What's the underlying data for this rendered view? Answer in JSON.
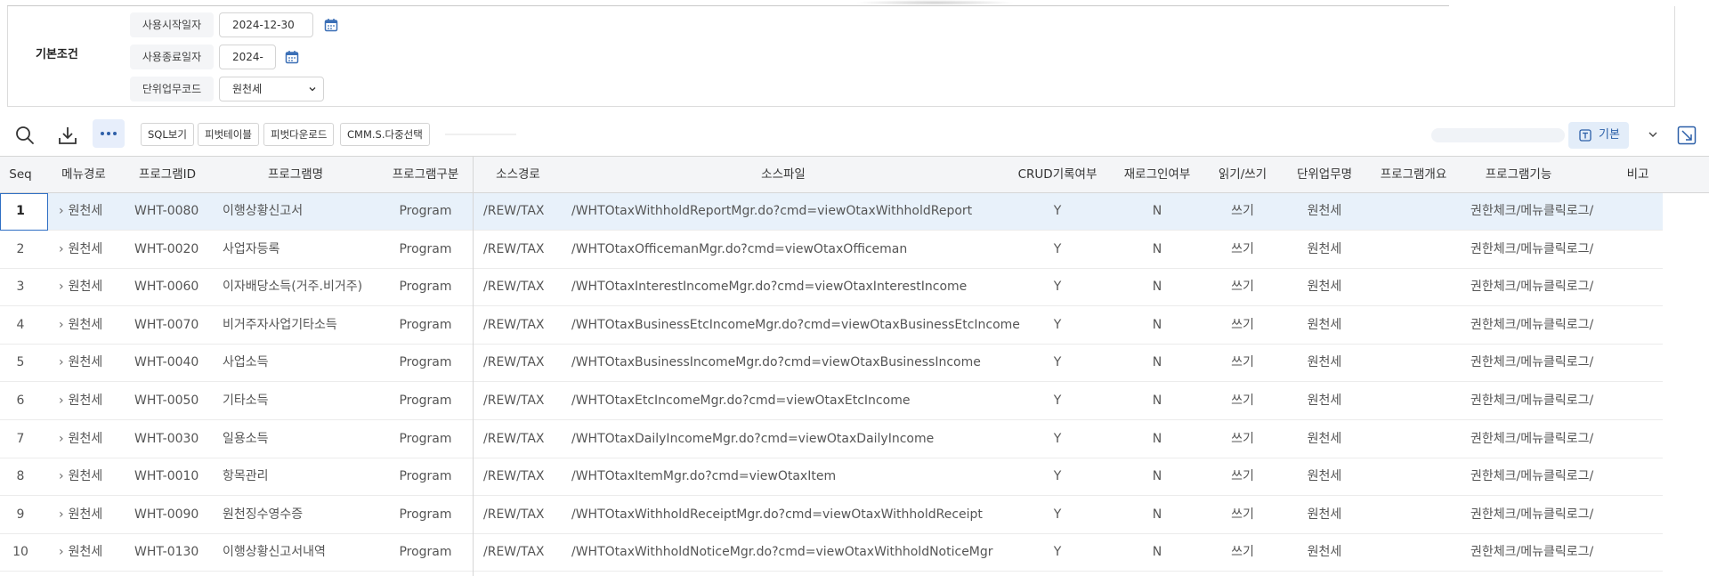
{
  "conditions": {
    "section_title": "기본조건",
    "start_date": {
      "label": "사용시작일자",
      "value": "2024-12-30"
    },
    "end_date": {
      "label": "사용종료일자",
      "value": "2024-"
    },
    "unit_code": {
      "label": "단위업무코드",
      "value": "원천세"
    }
  },
  "toolbar": {
    "buttons": [
      "SQL보기",
      "피벗테이블",
      "피벗다운로드",
      "CMM.S.다중선택"
    ],
    "basic_label": "기본"
  },
  "grid": {
    "columns": [
      "Seq",
      "메뉴경로",
      "프로그램ID",
      "프로그램명",
      "프로그램구분",
      "소스경로",
      "소스파일",
      "CRUD기록여부",
      "재로그인여부",
      "읽기/쓰기",
      "단위업무명",
      "프로그램개요",
      "프로그램기능",
      "비고"
    ],
    "rows": [
      {
        "seq": "1",
        "menu": "원천세",
        "id": "WHT-0080",
        "name": "이행상황신고서",
        "type": "Program",
        "path": "/REW/TAX",
        "file": "/WHTOtaxWithholdReportMgr.do?cmd=viewOtaxWithholdReport",
        "crud": "Y",
        "relogin": "N",
        "rw": "쓰기",
        "unit": "원천세",
        "summary": "",
        "func": "권한체크/메뉴클릭로그/",
        "note": ""
      },
      {
        "seq": "2",
        "menu": "원천세",
        "id": "WHT-0020",
        "name": "사업자등록",
        "type": "Program",
        "path": "/REW/TAX",
        "file": "/WHTOtaxOfficemanMgr.do?cmd=viewOtaxOfficeman",
        "crud": "Y",
        "relogin": "N",
        "rw": "쓰기",
        "unit": "원천세",
        "summary": "",
        "func": "권한체크/메뉴클릭로그/",
        "note": ""
      },
      {
        "seq": "3",
        "menu": "원천세",
        "id": "WHT-0060",
        "name": "이자배당소득(거주.비거주)",
        "type": "Program",
        "path": "/REW/TAX",
        "file": "/WHTOtaxInterestIncomeMgr.do?cmd=viewOtaxInterestIncome",
        "crud": "Y",
        "relogin": "N",
        "rw": "쓰기",
        "unit": "원천세",
        "summary": "",
        "func": "권한체크/메뉴클릭로그/",
        "note": ""
      },
      {
        "seq": "4",
        "menu": "원천세",
        "id": "WHT-0070",
        "name": "비거주자사업기타소득",
        "type": "Program",
        "path": "/REW/TAX",
        "file": "/WHTOtaxBusinessEtcIncomeMgr.do?cmd=viewOtaxBusinessEtcIncome",
        "crud": "Y",
        "relogin": "N",
        "rw": "쓰기",
        "unit": "원천세",
        "summary": "",
        "func": "권한체크/메뉴클릭로그/",
        "note": ""
      },
      {
        "seq": "5",
        "menu": "원천세",
        "id": "WHT-0040",
        "name": "사업소득",
        "type": "Program",
        "path": "/REW/TAX",
        "file": "/WHTOtaxBusinessIncomeMgr.do?cmd=viewOtaxBusinessIncome",
        "crud": "Y",
        "relogin": "N",
        "rw": "쓰기",
        "unit": "원천세",
        "summary": "",
        "func": "권한체크/메뉴클릭로그/",
        "note": ""
      },
      {
        "seq": "6",
        "menu": "원천세",
        "id": "WHT-0050",
        "name": "기타소득",
        "type": "Program",
        "path": "/REW/TAX",
        "file": "/WHTOtaxEtcIncomeMgr.do?cmd=viewOtaxEtcIncome",
        "crud": "Y",
        "relogin": "N",
        "rw": "쓰기",
        "unit": "원천세",
        "summary": "",
        "func": "권한체크/메뉴클릭로그/",
        "note": ""
      },
      {
        "seq": "7",
        "menu": "원천세",
        "id": "WHT-0030",
        "name": "일용소득",
        "type": "Program",
        "path": "/REW/TAX",
        "file": "/WHTOtaxDailyIncomeMgr.do?cmd=viewOtaxDailyIncome",
        "crud": "Y",
        "relogin": "N",
        "rw": "쓰기",
        "unit": "원천세",
        "summary": "",
        "func": "권한체크/메뉴클릭로그/",
        "note": ""
      },
      {
        "seq": "8",
        "menu": "원천세",
        "id": "WHT-0010",
        "name": "항목관리",
        "type": "Program",
        "path": "/REW/TAX",
        "file": "/WHTOtaxItemMgr.do?cmd=viewOtaxItem",
        "crud": "Y",
        "relogin": "N",
        "rw": "쓰기",
        "unit": "원천세",
        "summary": "",
        "func": "권한체크/메뉴클릭로그/",
        "note": ""
      },
      {
        "seq": "9",
        "menu": "원천세",
        "id": "WHT-0090",
        "name": "원천징수영수증",
        "type": "Program",
        "path": "/REW/TAX",
        "file": "/WHTOtaxWithholdReceiptMgr.do?cmd=viewOtaxWithholdReceipt",
        "crud": "Y",
        "relogin": "N",
        "rw": "쓰기",
        "unit": "원천세",
        "summary": "",
        "func": "권한체크/메뉴클릭로그/",
        "note": ""
      },
      {
        "seq": "10",
        "menu": "원천세",
        "id": "WHT-0130",
        "name": "이행상황신고서내역",
        "type": "Program",
        "path": "/REW/TAX",
        "file": "/WHTOtaxWithholdNoticeMgr.do?cmd=viewOtaxWithholdNoticeMgr",
        "crud": "Y",
        "relogin": "N",
        "rw": "쓰기",
        "unit": "원천세",
        "summary": "",
        "func": "권한체크/메뉴클릭로그/",
        "note": ""
      }
    ]
  },
  "colors": {
    "accent": "#2f6fc4",
    "selected_row": "#e8f1fa",
    "header_bg": "#f4f5f7"
  }
}
